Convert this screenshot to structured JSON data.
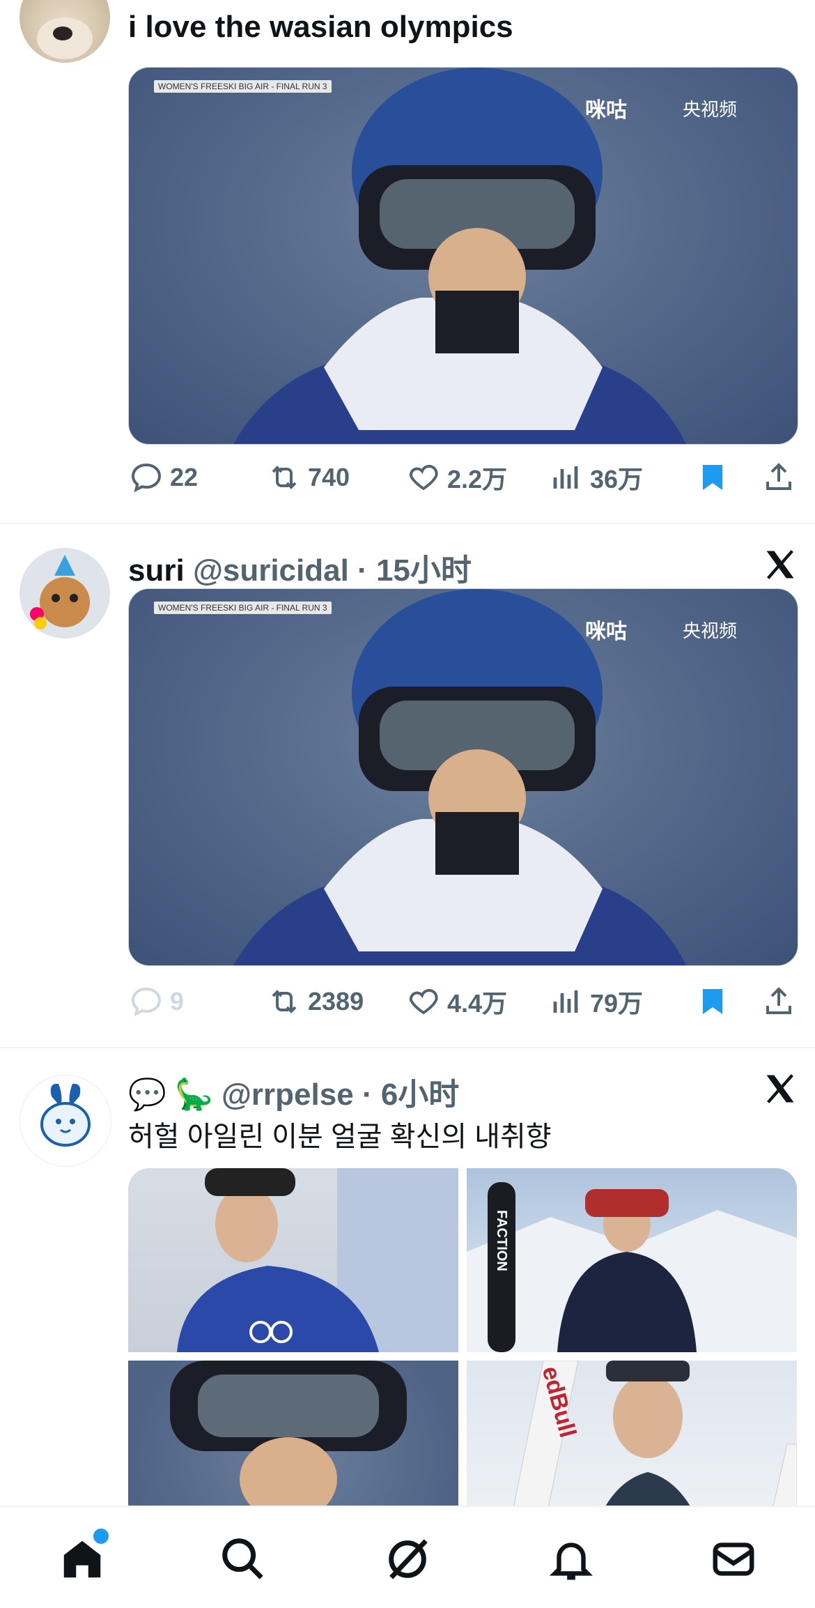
{
  "post1": {
    "text": "i love the wasian olympics",
    "media_caption": "WOMEN'S FREESKI BIG AIR - FINAL RUN 3",
    "watermark_migu": "咪咕",
    "watermark_cctv": "央视频",
    "replies": "22",
    "reposts": "740",
    "likes": "2.2万",
    "views": "36万"
  },
  "post2": {
    "name": "suri",
    "handle": "@suricidal",
    "time": "15小时",
    "media_caption": "WOMEN'S FREESKI BIG AIR - FINAL RUN 3",
    "watermark_migu": "咪咕",
    "watermark_cctv": "央视频",
    "replies": "9",
    "reposts": "2389",
    "likes": "4.4万",
    "views": "79万"
  },
  "post3": {
    "emoji_prefix": "💬 🦕",
    "handle": "@rrpelse",
    "time": "6小时",
    "text": "허헐 아일린 이분 얼굴 확신의 내취향",
    "grid_labels": [
      "FACTION",
      "edBull"
    ]
  },
  "colors": {
    "accent": "#1d9bf0",
    "muted": "#536471"
  },
  "icons": [
    "reply-icon",
    "repost-icon",
    "like-icon",
    "views-icon",
    "bookmark-icon",
    "share-icon",
    "x-logo-icon",
    "home-icon",
    "search-icon",
    "grok-icon",
    "notifications-icon",
    "messages-icon"
  ]
}
